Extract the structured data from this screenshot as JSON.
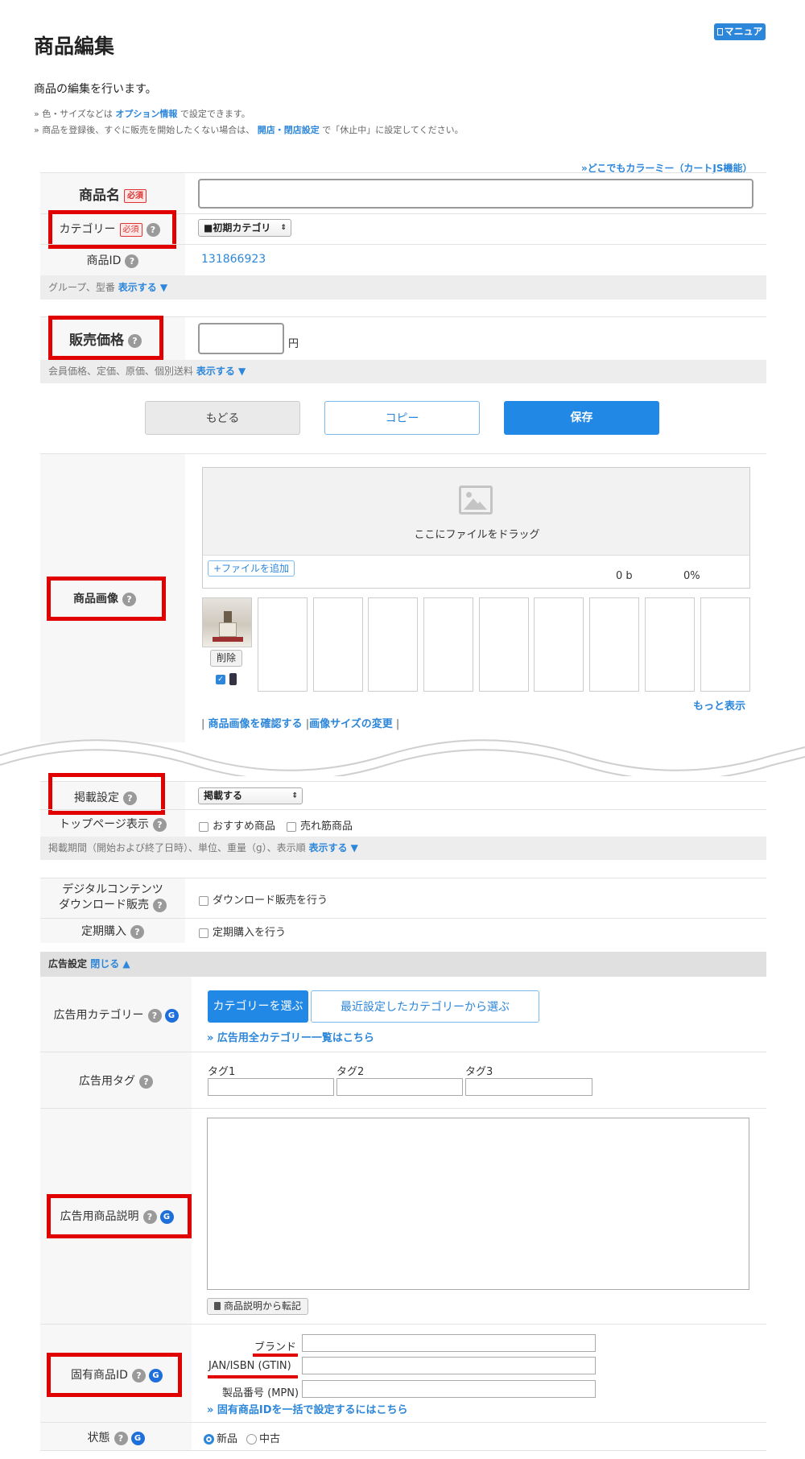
{
  "header": {
    "title": "商品編集",
    "manual_label": "マニュアル",
    "description": "商品の編集を行います。",
    "note1_prefix": "» 色・サイズなどは ",
    "note1_link": "オプション情報",
    "note1_suffix": " で設定できます。",
    "note2_prefix": "» 商品を登録後、すぐに販売を開始したくない場合は、 ",
    "note2_link": "開店・閉店設定",
    "note2_suffix": " で「休止中」に設定してください。",
    "top_right_link": "»どこでもカラーミー（カートJS機能）"
  },
  "basic": {
    "name_label": "商品名",
    "required": "必須",
    "category_label": "カテゴリー",
    "category_value": "■初期カテゴリ",
    "id_label": "商品ID",
    "id_value": "131866923",
    "group_bar_text": "グループ、型番",
    "show_link": "表示する ▼"
  },
  "price": {
    "label": "販売価格",
    "unit": "円",
    "bar_text": "会員価格、定価、原価、個別送料",
    "show_link": "表示する ▼"
  },
  "actions": {
    "back": "もどる",
    "copy": "コピー",
    "save": "保存"
  },
  "images": {
    "label": "商品画像",
    "drop_text": "ここにファイルをドラッグ",
    "add_file": "+ファイルを追加",
    "size": "0 b",
    "progress": "0%",
    "delete": "削除",
    "more": "もっと表示",
    "confirm_link": "商品画像を確認する",
    "resize_link": "画像サイズの変更",
    "sep": "|"
  },
  "publish": {
    "label": "掲載設定",
    "value": "掲載する",
    "top_label": "トップページ表示",
    "recommend": "おすすめ商品",
    "bestseller": "売れ筋商品",
    "bar_text": "掲載期間（開始および終了日時）、単位、重量（g）、表示順",
    "show_link": "表示する ▼"
  },
  "digital": {
    "label1": "デジタルコンテンツ",
    "label2": "ダウンロード販売",
    "checkbox": "ダウンロード販売を行う"
  },
  "subscription": {
    "label": "定期購入",
    "checkbox": "定期購入を行う"
  },
  "ads": {
    "section_label": "広告設定",
    "close_link": "閉じる ▲",
    "category_label": "広告用カテゴリー",
    "choose_category": "カテゴリーを選ぶ",
    "recent_category": "最近設定したカテゴリーから選ぶ",
    "all_categories_link": "» 広告用全カテゴリー一覧はこちら",
    "tag_label": "広告用タグ",
    "tag1": "タグ1",
    "tag2": "タグ2",
    "tag3": "タグ3",
    "desc_label": "広告用商品説明",
    "copy_desc": "商品説明から転記",
    "unique_id_label": "固有商品ID",
    "brand": "ブランド",
    "gtin": "JAN/ISBN (GTIN)",
    "mpn": "製品番号 (MPN)",
    "bulk_link": "» 固有商品IDを一括で設定するにはこちら",
    "condition_label": "状態",
    "new": "新品",
    "used": "中古"
  },
  "colors": {
    "accent": "#2c86d9",
    "highlight_red": "#e00000",
    "save_button": "#2288e6"
  },
  "icons": [
    "manual-icon",
    "help-icon",
    "image-placeholder-icon",
    "google-icon",
    "clipboard-icon"
  ]
}
